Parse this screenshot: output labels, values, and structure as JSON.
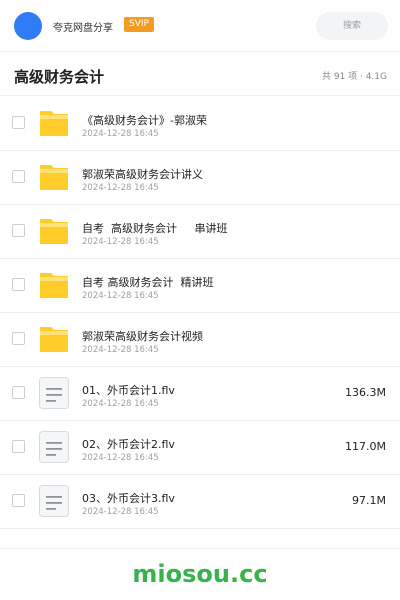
{
  "header": {
    "username": "夸克网盘分享",
    "badge": "SVIP",
    "search_placeholder": "搜索"
  },
  "folder": {
    "title": "高级财务会计",
    "summary": "共 91 项 · 4.1G"
  },
  "items": [
    {
      "name": "《高级财务会计》-郭淑荣",
      "date": "2024-12-28 16:45",
      "size": "",
      "icon": "folder-icon"
    },
    {
      "name": "郭淑荣高级财务会计讲义",
      "date": "2024-12-28 16:45",
      "size": "",
      "icon": "folder-icon"
    },
    {
      "name": "自考  高级财务会计     串讲班",
      "date": "2024-12-28 16:45",
      "size": "",
      "icon": "folder-icon"
    },
    {
      "name": "自考 高级财务会计  精讲班",
      "date": "2024-12-28 16:45",
      "size": "",
      "icon": "folder-icon"
    },
    {
      "name": "郭淑荣高级财务会计视频",
      "date": "2024-12-28 16:45",
      "size": "",
      "icon": "folder-icon"
    },
    {
      "name": "01、外币会计1.flv",
      "date": "2024-12-28 16:45",
      "size": "136.3M",
      "icon": "video-file-icon"
    },
    {
      "name": "02、外币会计2.flv",
      "date": "2024-12-28 16:45",
      "size": "117.0M",
      "icon": "video-file-icon"
    },
    {
      "name": "03、外币会计3.flv",
      "date": "2024-12-28 16:45",
      "size": "97.1M",
      "icon": "video-file-icon"
    }
  ],
  "footer": {
    "watermark": "miosou.cc"
  },
  "colors": {
    "accent": "#2f7cf6",
    "badge": "#f59a23",
    "folder": "#ffcc29",
    "watermark": "#37b24d"
  }
}
